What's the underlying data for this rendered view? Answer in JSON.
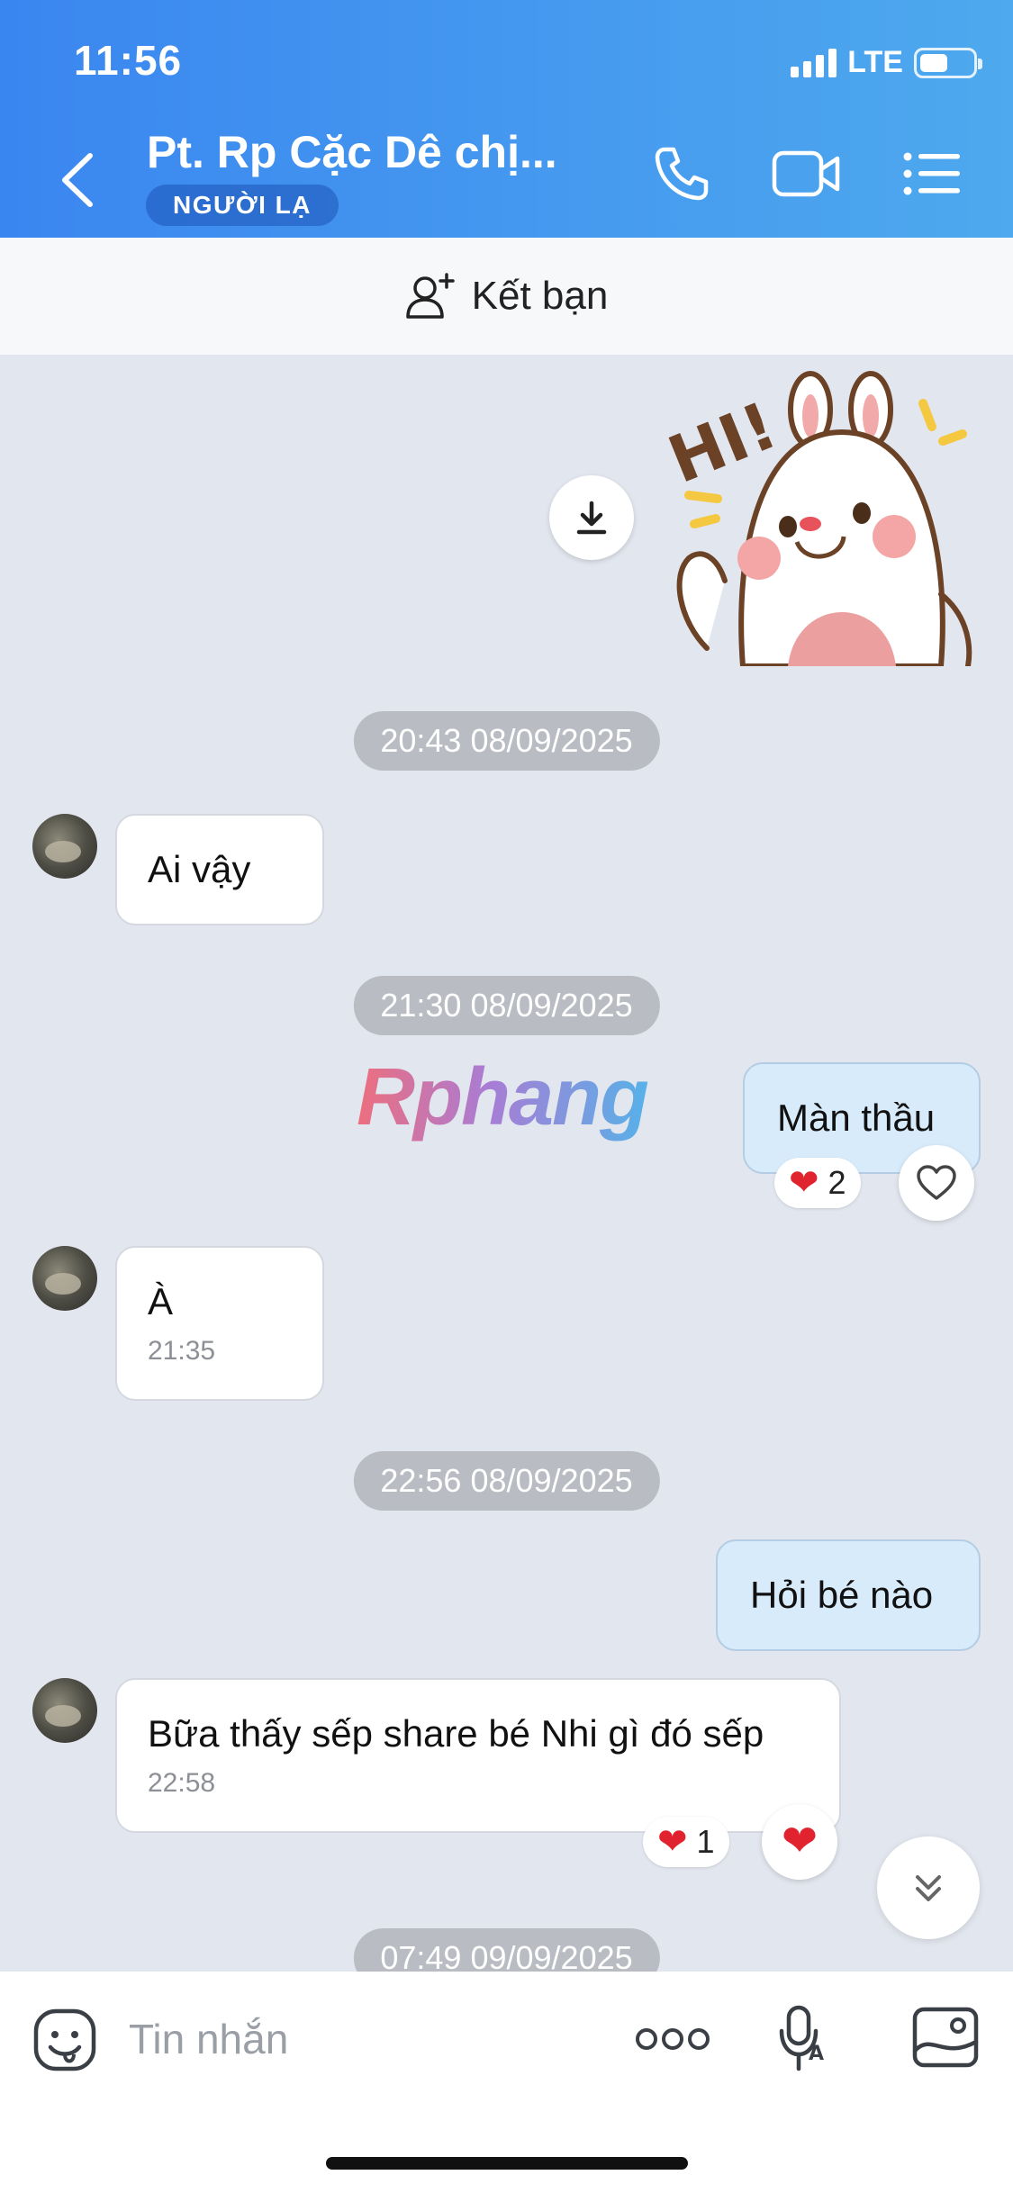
{
  "status_bar": {
    "time": "11:56",
    "network": "LTE"
  },
  "header": {
    "title": "Pt. Rp Cặc Dê chị...",
    "badge": "NGƯỜI LẠ",
    "colors": {
      "start": "#3a86f0",
      "end": "#4ea9ee"
    }
  },
  "add_friend": {
    "label": "Kết bạn"
  },
  "sticker": {
    "name": "hi-bunny-sticker",
    "text": "HI!"
  },
  "watermark": "Rphang",
  "messages": {
    "ts1": "20:43 08/09/2025",
    "m1": "Ai vậy",
    "ts2": "21:30 08/09/2025",
    "m2": "Màn thầu",
    "m2_reaction_count": "2",
    "m3": "À",
    "m3_time": "21:35",
    "ts3": "22:56 08/09/2025",
    "m4": "Hỏi bé nào",
    "m5": "Bữa thấy sếp share bé Nhi gì đó sếp",
    "m5_time": "22:58",
    "m5_reaction_count": "1",
    "ts4": "07:49 09/09/2025"
  },
  "input": {
    "placeholder": "Tin nhắn"
  }
}
